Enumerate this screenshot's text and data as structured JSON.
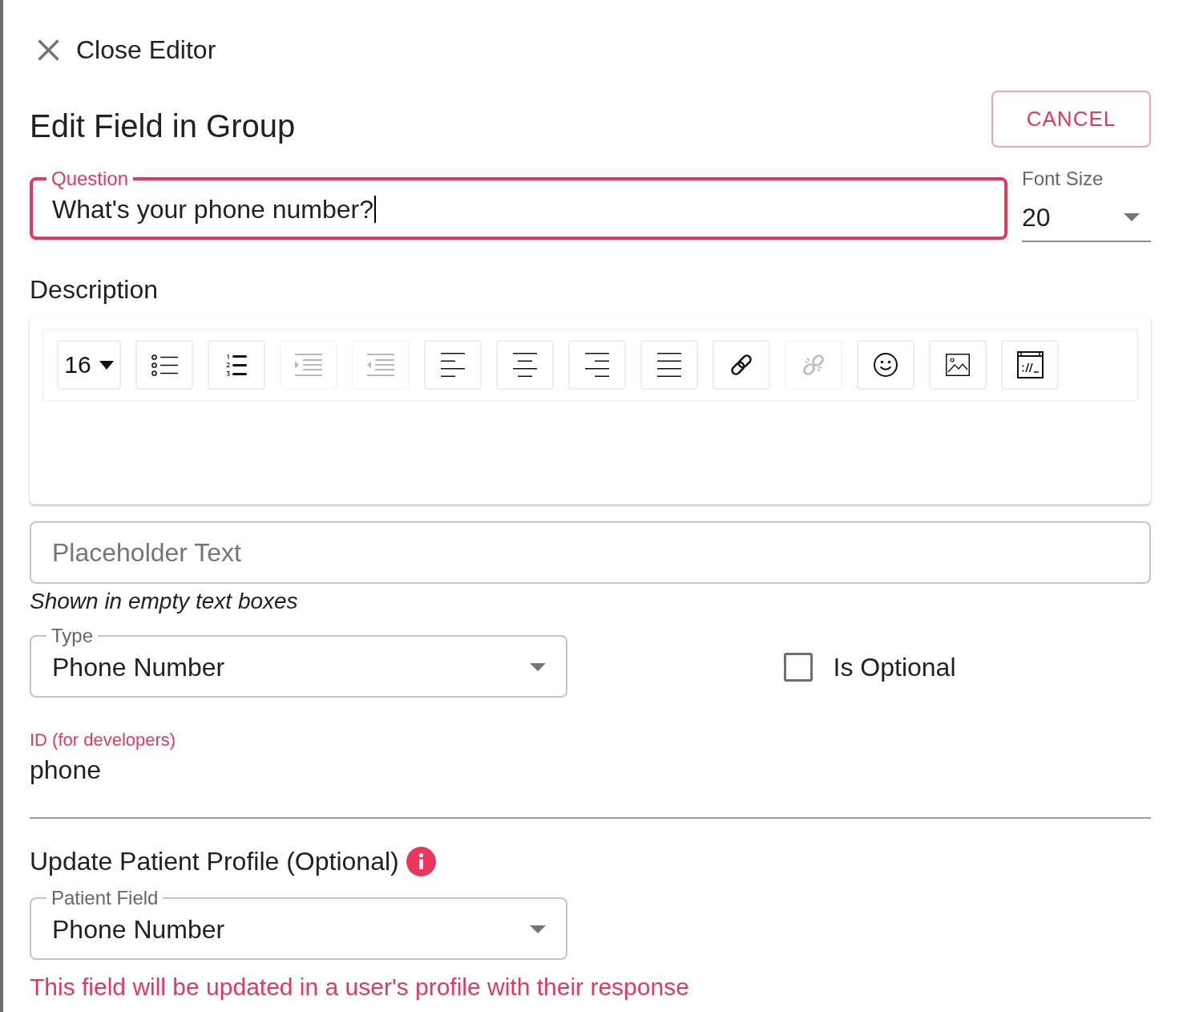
{
  "close_button": {
    "label": "Close Editor"
  },
  "header": {
    "title": "Edit Field in Group",
    "cancel_button": {
      "label": "CANCEL"
    }
  },
  "question_field": {
    "label": "Question",
    "value": "What's your phone number?",
    "focused": true
  },
  "font_size_select": {
    "label": "Font Size",
    "value": "20"
  },
  "description": {
    "label": "Description",
    "toolbar": [
      {
        "kind": "font_size",
        "label": "16",
        "disabled": false
      },
      {
        "kind": "bullet_list",
        "disabled": false
      },
      {
        "kind": "numbered_list",
        "disabled": false
      },
      {
        "kind": "indent",
        "disabled": true
      },
      {
        "kind": "outdent",
        "disabled": true
      },
      {
        "kind": "align_left",
        "disabled": false
      },
      {
        "kind": "align_center",
        "disabled": false
      },
      {
        "kind": "align_right",
        "disabled": false
      },
      {
        "kind": "justify",
        "disabled": false
      },
      {
        "kind": "link",
        "disabled": false
      },
      {
        "kind": "unlink",
        "disabled": true
      },
      {
        "kind": "emoji",
        "disabled": false
      },
      {
        "kind": "image",
        "disabled": false
      },
      {
        "kind": "embed",
        "disabled": false
      }
    ]
  },
  "placeholder_field": {
    "placeholder": "Placeholder Text",
    "helper_text": "Shown in empty text boxes"
  },
  "type_select": {
    "label": "Type",
    "value": "Phone Number"
  },
  "optional_checkbox": {
    "label": "Is Optional",
    "checked": false
  },
  "id_field": {
    "label": "ID (for developers)",
    "value": "phone"
  },
  "patient_profile": {
    "title": "Update Patient Profile (Optional)",
    "select": {
      "label": "Patient Field",
      "value": "Phone Number"
    },
    "helper_text": "This field will be updated in a user's profile with their response"
  }
}
